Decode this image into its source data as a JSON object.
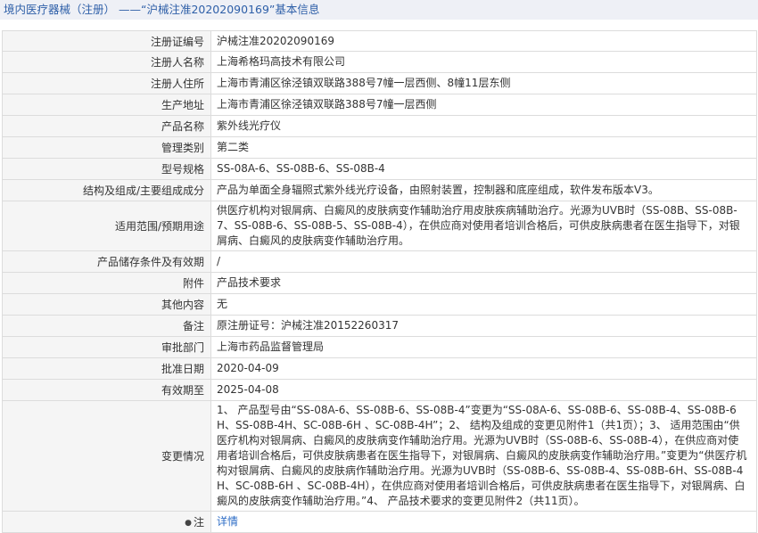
{
  "header": {
    "title": "境内医疗器械（注册）  ——“沪械注准20202090169”基本信息"
  },
  "rows": [
    {
      "label": "注册证编号",
      "value": "沪械注准20202090169"
    },
    {
      "label": "注册人名称",
      "value": "上海希格玛高技术有限公司"
    },
    {
      "label": "注册人住所",
      "value": "上海市青浦区徐泾镇双联路388号7幢一层西侧、8幢11层东侧"
    },
    {
      "label": "生产地址",
      "value": "上海市青浦区徐泾镇双联路388号7幢一层西侧"
    },
    {
      "label": "产品名称",
      "value": "紫外线光疗仪"
    },
    {
      "label": "管理类别",
      "value": "第二类"
    },
    {
      "label": "型号规格",
      "value": "SS-08A-6、SS-08B-6、SS-08B-4"
    },
    {
      "label": "结构及组成/主要组成成分",
      "value": "产品为单面全身辐照式紫外线光疗设备，由照射装置，控制器和底座组成，软件发布版本V3。"
    },
    {
      "label": "适用范围/预期用途",
      "value": "供医疗机构对银屑病、白癜风的皮肤病变作辅助治疗用皮肤疾病辅助治疗。光源为UVB时（SS-08B、SS-08B-7、SS-08B-6、SS-08B-5、SS-08B-4），在供应商对使用者培训合格后，可供皮肤病患者在医生指导下，对银屑病、白癜风的皮肤病变作辅助治疗用。"
    },
    {
      "label": "产品储存条件及有效期",
      "value": "/"
    },
    {
      "label": "附件",
      "value": "产品技术要求"
    },
    {
      "label": "其他内容",
      "value": "无"
    },
    {
      "label": "备注",
      "value": "原注册证号：沪械注准20152260317"
    },
    {
      "label": "审批部门",
      "value": "上海市药品监督管理局"
    },
    {
      "label": "批准日期",
      "value": "2020-04-09"
    },
    {
      "label": "有效期至",
      "value": "2025-04-08"
    },
    {
      "label": "变更情况",
      "value": "1、 产品型号由“SS-08A-6、SS-08B-6、SS-08B-4”变更为“SS-08A-6、SS-08B-6、SS-08B-4、SS-08B-6H、SS-08B-4H、SC-08B-6H 、SC-08B-4H”；2、 结构及组成的变更见附件1（共1页）；3、 适用范围由“供医疗机构对银屑病、白癜风的皮肤病变作辅助治疗用。光源为UVB时（SS-08B-6、SS-08B-4），在供应商对使用者培训合格后，可供皮肤病患者在医生指导下，对银屑病、白癜风的皮肤病变作辅助治疗用。”变更为“供医疗机构对银屑病、白癜风的皮肤病作辅助治疗用。光源为UVB时（SS-08B-6、SS-08B-4、SS-08B-6H、SS-08B-4H、SC-08B-6H 、SC-08B-4H），在供应商对使用者培训合格后，可供皮肤病患者在医生指导下，对银屑病、白癜风的皮肤病变作辅助治疗用。”4、 产品技术要求的变更见附件2（共11页）。"
    }
  ],
  "note_row": {
    "label": "注",
    "link": "详情"
  }
}
